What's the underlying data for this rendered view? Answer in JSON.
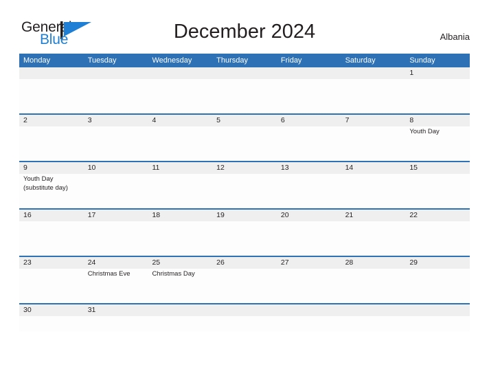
{
  "branding": {
    "logo_word_1": "General",
    "logo_word_2": "Blue",
    "logo_icon": "blue-flag-triangle-icon",
    "logo_color_dark": "#231f20",
    "logo_color_blue": "#1f7fd4"
  },
  "header": {
    "title": "December 2024",
    "region": "Albania"
  },
  "theme": {
    "header_blue": "#2e71b5",
    "daynum_band_gray": "#efefef",
    "cell_white": "#fdfdfd",
    "text_dark": "#231f20"
  },
  "calendar": {
    "month": "December",
    "year": "2024",
    "weekday_headers": [
      "Monday",
      "Tuesday",
      "Wednesday",
      "Thursday",
      "Friday",
      "Saturday",
      "Sunday"
    ],
    "weeks": [
      {
        "cells": [
          {
            "day": "",
            "event": ""
          },
          {
            "day": "",
            "event": ""
          },
          {
            "day": "",
            "event": ""
          },
          {
            "day": "",
            "event": ""
          },
          {
            "day": "",
            "event": ""
          },
          {
            "day": "",
            "event": ""
          },
          {
            "day": "1",
            "event": ""
          }
        ]
      },
      {
        "cells": [
          {
            "day": "2",
            "event": ""
          },
          {
            "day": "3",
            "event": ""
          },
          {
            "day": "4",
            "event": ""
          },
          {
            "day": "5",
            "event": ""
          },
          {
            "day": "6",
            "event": ""
          },
          {
            "day": "7",
            "event": ""
          },
          {
            "day": "8",
            "event": "Youth Day"
          }
        ]
      },
      {
        "cells": [
          {
            "day": "9",
            "event": "Youth Day\n(substitute day)"
          },
          {
            "day": "10",
            "event": ""
          },
          {
            "day": "11",
            "event": ""
          },
          {
            "day": "12",
            "event": ""
          },
          {
            "day": "13",
            "event": ""
          },
          {
            "day": "14",
            "event": ""
          },
          {
            "day": "15",
            "event": ""
          }
        ]
      },
      {
        "cells": [
          {
            "day": "16",
            "event": ""
          },
          {
            "day": "17",
            "event": ""
          },
          {
            "day": "18",
            "event": ""
          },
          {
            "day": "19",
            "event": ""
          },
          {
            "day": "20",
            "event": ""
          },
          {
            "day": "21",
            "event": ""
          },
          {
            "day": "22",
            "event": ""
          }
        ]
      },
      {
        "cells": [
          {
            "day": "23",
            "event": ""
          },
          {
            "day": "24",
            "event": "Christmas Eve"
          },
          {
            "day": "25",
            "event": "Christmas Day"
          },
          {
            "day": "26",
            "event": ""
          },
          {
            "day": "27",
            "event": ""
          },
          {
            "day": "28",
            "event": ""
          },
          {
            "day": "29",
            "event": ""
          }
        ]
      },
      {
        "short": true,
        "cells": [
          {
            "day": "30",
            "event": ""
          },
          {
            "day": "31",
            "event": ""
          },
          {
            "day": "",
            "event": ""
          },
          {
            "day": "",
            "event": ""
          },
          {
            "day": "",
            "event": ""
          },
          {
            "day": "",
            "event": ""
          },
          {
            "day": "",
            "event": ""
          }
        ]
      }
    ]
  }
}
